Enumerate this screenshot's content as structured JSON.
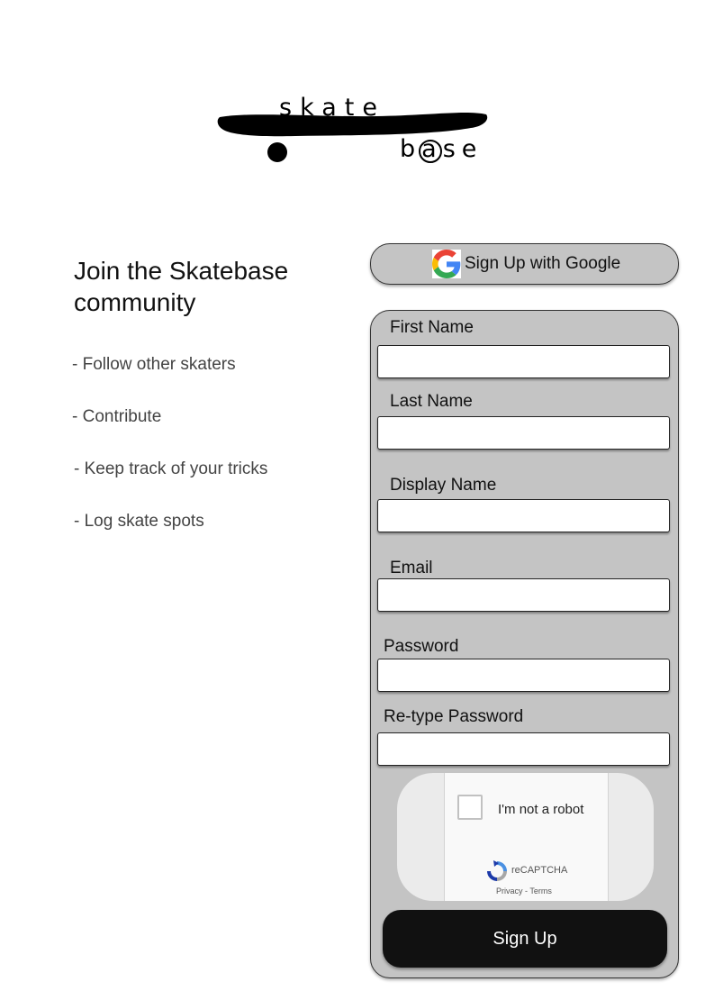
{
  "logo": {
    "top_text": "skate",
    "bottom_text_start": "b",
    "bottom_text_circle": "a",
    "bottom_text_end": "se"
  },
  "intro": {
    "heading": "Join the Skatebase community",
    "features": [
      "- Follow other skaters",
      "- Contribute",
      "- Keep track of your tricks",
      "- Log skate spots"
    ]
  },
  "google_button": {
    "label": "Sign Up with Google",
    "icon": "google-g-icon"
  },
  "form": {
    "first_name": {
      "label": "First Name",
      "value": ""
    },
    "last_name": {
      "label": "Last Name",
      "value": ""
    },
    "display_name": {
      "label": "Display Name",
      "value": ""
    },
    "email": {
      "label": "Email",
      "value": ""
    },
    "password": {
      "label": "Password",
      "value": ""
    },
    "retype_password": {
      "label": "Re-type Password",
      "value": ""
    },
    "submit_label": "Sign Up"
  },
  "recaptcha": {
    "checkbox_label": "I'm not a robot",
    "brand": "reCAPTCHA",
    "privacy_link": "Privacy",
    "separator": " - ",
    "terms_link": "Terms"
  },
  "colors": {
    "card_bg": "#c4c4c4",
    "button_bg": "#111111",
    "page_bg": "#ffffff"
  }
}
